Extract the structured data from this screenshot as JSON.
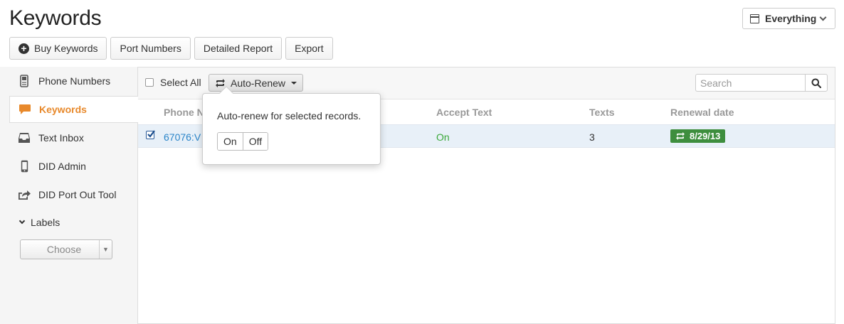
{
  "page_title": "Keywords",
  "filter": {
    "label": "Everything"
  },
  "toolbar": {
    "buy_keywords": "Buy Keywords",
    "port_numbers": "Port Numbers",
    "detailed_report": "Detailed Report",
    "export": "Export"
  },
  "sidebar": {
    "items": [
      {
        "label": "Phone Numbers",
        "icon": "phone-icon"
      },
      {
        "label": "Keywords",
        "icon": "chat-bubble-icon",
        "active": true
      },
      {
        "label": "Text Inbox",
        "icon": "inbox-icon"
      },
      {
        "label": "DID Admin",
        "icon": "mobile-icon"
      },
      {
        "label": "DID Port Out Tool",
        "icon": "share-icon"
      }
    ],
    "labels_toggle": "Labels",
    "choose": "Choose"
  },
  "main": {
    "select_all": "Select All",
    "auto_renew": "Auto-Renew",
    "search_placeholder": "Search",
    "columns": [
      "Phone N",
      "Accept Text",
      "Texts",
      "Renewal date"
    ],
    "rows": [
      {
        "phone": "67076:V",
        "accept_text": "On",
        "texts": "3",
        "renewal_date": "8/29/13"
      }
    ]
  },
  "popover": {
    "message": "Auto-renew for selected records.",
    "on": "On",
    "off": "Off"
  },
  "colors": {
    "accent": "#e8892b",
    "link": "#2a85c9",
    "success": "#3aa83a",
    "badge": "#3e8e3e"
  }
}
